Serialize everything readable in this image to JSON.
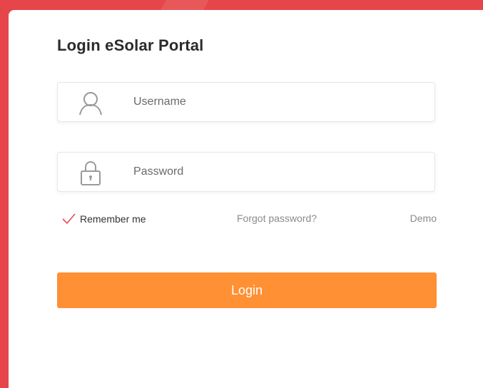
{
  "form": {
    "title": "Login eSolar Portal",
    "username": {
      "value": "",
      "placeholder": "Username",
      "icon": "user-icon"
    },
    "password": {
      "value": "",
      "placeholder": "Password",
      "icon": "lock-icon"
    },
    "remember": {
      "label": "Remember me",
      "checked": true
    },
    "forgot_label": "Forgot password?",
    "demo_label": "Demo",
    "login_label": "Login"
  },
  "colors": {
    "background": "#e64649",
    "accent": "#ff9033",
    "checkmark": "#e84a4d"
  }
}
